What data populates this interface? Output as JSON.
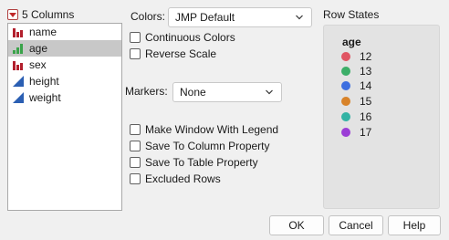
{
  "columns_panel": {
    "header": "5 Columns",
    "items": [
      {
        "label": "name",
        "icon": "nominal-bar-icon",
        "selected": false
      },
      {
        "label": "age",
        "icon": "ordinal-bar-icon",
        "selected": true
      },
      {
        "label": "sex",
        "icon": "nominal-bar-icon",
        "selected": false
      },
      {
        "label": "height",
        "icon": "continuous-triangle-icon",
        "selected": false
      },
      {
        "label": "weight",
        "icon": "continuous-triangle-icon",
        "selected": false
      }
    ]
  },
  "colors": {
    "label": "Colors:",
    "selected": "JMP Default",
    "continuous_label": "Continuous Colors",
    "reverse_label": "Reverse Scale"
  },
  "markers": {
    "label": "Markers:",
    "selected": "None"
  },
  "options": {
    "legend": "Make Window With Legend",
    "column_property": "Save To Column Property",
    "table_property": "Save To Table Property",
    "excluded": "Excluded Rows"
  },
  "row_states": {
    "title": "Row States",
    "legend_title": "age",
    "items": [
      {
        "label": "12",
        "color": "#e05563"
      },
      {
        "label": "13",
        "color": "#3cae68"
      },
      {
        "label": "14",
        "color": "#3d6fe0"
      },
      {
        "label": "15",
        "color": "#d8832a"
      },
      {
        "label": "16",
        "color": "#33b3a4"
      },
      {
        "label": "17",
        "color": "#9b3ed6"
      }
    ]
  },
  "buttons": {
    "ok": "OK",
    "cancel": "Cancel",
    "help": "Help"
  },
  "theme": {
    "nominal_red": "#b21f2d",
    "ordinal_green": "#3aa34a",
    "continuous_blue": "#2b5fb3"
  }
}
